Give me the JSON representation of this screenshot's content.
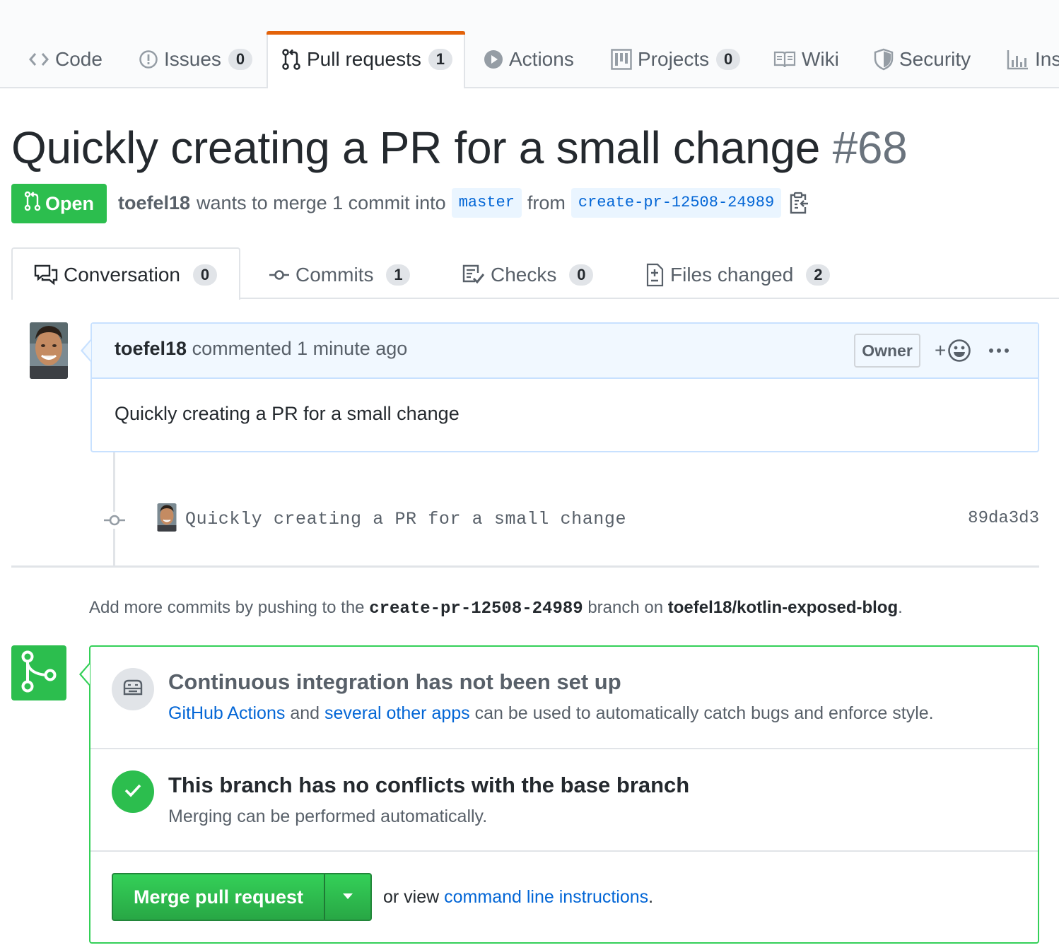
{
  "repo_nav": {
    "tabs": [
      {
        "label": "Code",
        "icon": "code-icon"
      },
      {
        "label": "Issues",
        "count": "0",
        "icon": "issue-icon"
      },
      {
        "label": "Pull requests",
        "count": "1",
        "icon": "pull-request-icon",
        "selected": true
      },
      {
        "label": "Actions",
        "icon": "play-icon"
      },
      {
        "label": "Projects",
        "count": "0",
        "icon": "project-icon"
      },
      {
        "label": "Wiki",
        "icon": "book-icon"
      },
      {
        "label": "Security",
        "icon": "shield-icon"
      },
      {
        "label": "Ins",
        "icon": "graph-icon"
      }
    ],
    "selected_accent": "#e36209"
  },
  "pr": {
    "title": "Quickly creating a PR for a small change",
    "number": "#68",
    "state": "Open",
    "state_color": "#2cbe4e",
    "author": "toefel18",
    "merge_text": "wants to merge 1 commit into",
    "base_branch": "master",
    "from_text": "from",
    "head_branch": "create-pr-12508-24989",
    "copy_icon": "clippy-icon"
  },
  "pr_tabs": [
    {
      "label": "Conversation",
      "count": "0",
      "icon": "comment-discussion-icon",
      "selected": true
    },
    {
      "label": "Commits",
      "count": "1",
      "icon": "commit-icon"
    },
    {
      "label": "Checks",
      "count": "0",
      "icon": "checklist-icon"
    },
    {
      "label": "Files changed",
      "count": "2",
      "icon": "file-diff-icon"
    }
  ],
  "comment": {
    "author": "toefel18",
    "action": "commented",
    "time": "1 minute ago",
    "role": "Owner",
    "reaction_plus": "+",
    "body": "Quickly creating a PR for a small change"
  },
  "commit": {
    "message": "Quickly creating a PR for a small change",
    "sha": "89da3d3"
  },
  "push_hint": {
    "prefix": "Add more commits by pushing to the",
    "branch": "create-pr-12508-24989",
    "middle": "branch on",
    "repo": "toefel18/kotlin-exposed-blog",
    "suffix": "."
  },
  "merge": {
    "ci_title": "Continuous integration has not been set up",
    "ci_link1": "GitHub Actions",
    "ci_and": "and",
    "ci_link2": "several other apps",
    "ci_rest": "can be used to automatically catch bugs and enforce style.",
    "ok_title": "This branch has no conflicts with the base branch",
    "ok_sub": "Merging can be performed automatically.",
    "button": "Merge pull request",
    "alt_prefix": "or view",
    "alt_link": "command line instructions",
    "alt_suffix": "."
  }
}
